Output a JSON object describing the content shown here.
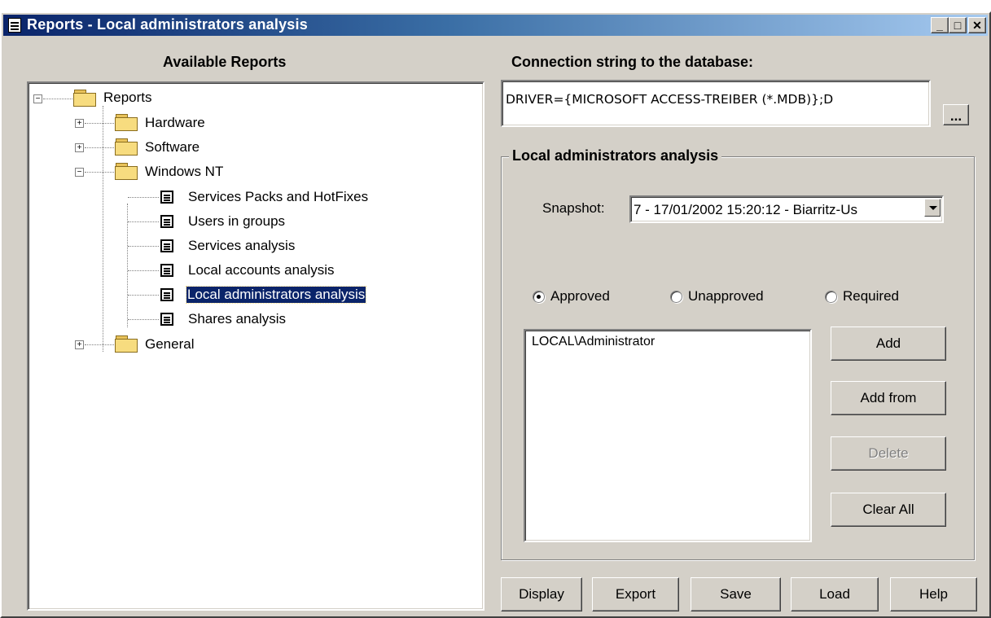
{
  "window": {
    "title": "Reports - Local administrators analysis",
    "minimize": "_",
    "maximize": "□",
    "close": "✕"
  },
  "left_panel": {
    "title": "Available Reports",
    "tree": {
      "root": "Reports",
      "hardware": "Hardware",
      "software": "Software",
      "windows_nt": "Windows NT",
      "children": [
        "Services Packs and HotFixes",
        "Users in groups",
        "Services analysis",
        "Local accounts analysis",
        "Local administrators analysis",
        "Shares analysis"
      ],
      "general": "General",
      "plus": "+",
      "minus": "−"
    }
  },
  "connection": {
    "label": "Connection string to the database:",
    "value": "DRIVER={MICROSOFT ACCESS-TREIBER (*.MDB)};D",
    "browse_label": "..."
  },
  "analysis": {
    "group_title": "Local administrators analysis",
    "snapshot_label": "Snapshot:",
    "snapshot_value": "7 - 17/01/2002 15:20:12 - Biarritz-Us",
    "radios": {
      "approved": "Approved",
      "unapproved": "Unapproved",
      "required": "Required"
    },
    "list_items": [
      "LOCAL\\Administrator"
    ],
    "buttons": {
      "add": "Add",
      "add_from": "Add from",
      "delete": "Delete",
      "clear_all": "Clear All"
    }
  },
  "bottom_buttons": {
    "display": "Display",
    "export": "Export",
    "save": "Save",
    "load": "Load",
    "help": "Help"
  }
}
